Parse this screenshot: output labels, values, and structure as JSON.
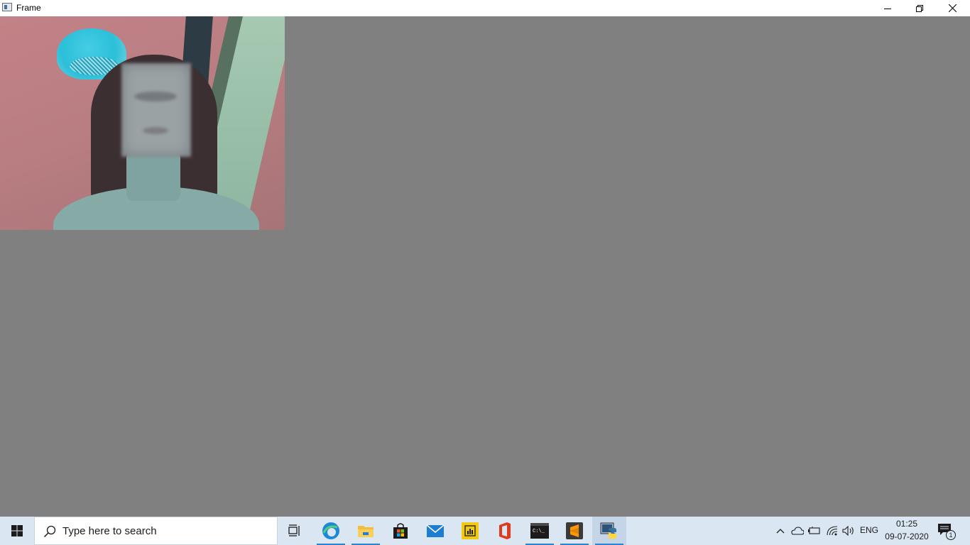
{
  "window": {
    "title": "Frame",
    "controls": {
      "minimize": "minimize-icon",
      "maximize": "restore-icon",
      "close": "close-icon"
    }
  },
  "content": {
    "webcam_image": "webcam-frame",
    "background_color": "#808080"
  },
  "taskbar": {
    "start_icon": "windows-logo-icon",
    "search_placeholder": "Type here to search",
    "pinned": [
      {
        "name": "task-view",
        "icon": "task-view-icon",
        "running": false
      },
      {
        "name": "edge",
        "icon": "edge-icon",
        "running": true
      },
      {
        "name": "file-explorer",
        "icon": "folder-icon",
        "running": true
      },
      {
        "name": "microsoft-store",
        "icon": "store-icon",
        "running": false
      },
      {
        "name": "mail",
        "icon": "mail-icon",
        "running": false
      },
      {
        "name": "power-bi",
        "icon": "power-bi-icon",
        "running": false
      },
      {
        "name": "office",
        "icon": "office-icon",
        "running": false
      },
      {
        "name": "command-prompt",
        "icon": "terminal-icon",
        "running": true
      },
      {
        "name": "sublime-text",
        "icon": "sublime-icon",
        "running": true
      },
      {
        "name": "python",
        "icon": "python-icon",
        "running": true,
        "active": true
      }
    ],
    "tray": {
      "icons": [
        "chevron-up-icon",
        "onedrive-icon",
        "battery-icon",
        "wifi-icon",
        "volume-icon"
      ],
      "language": "ENG",
      "time": "01:25",
      "date": "09-07-2020",
      "notification_count": "1"
    }
  }
}
